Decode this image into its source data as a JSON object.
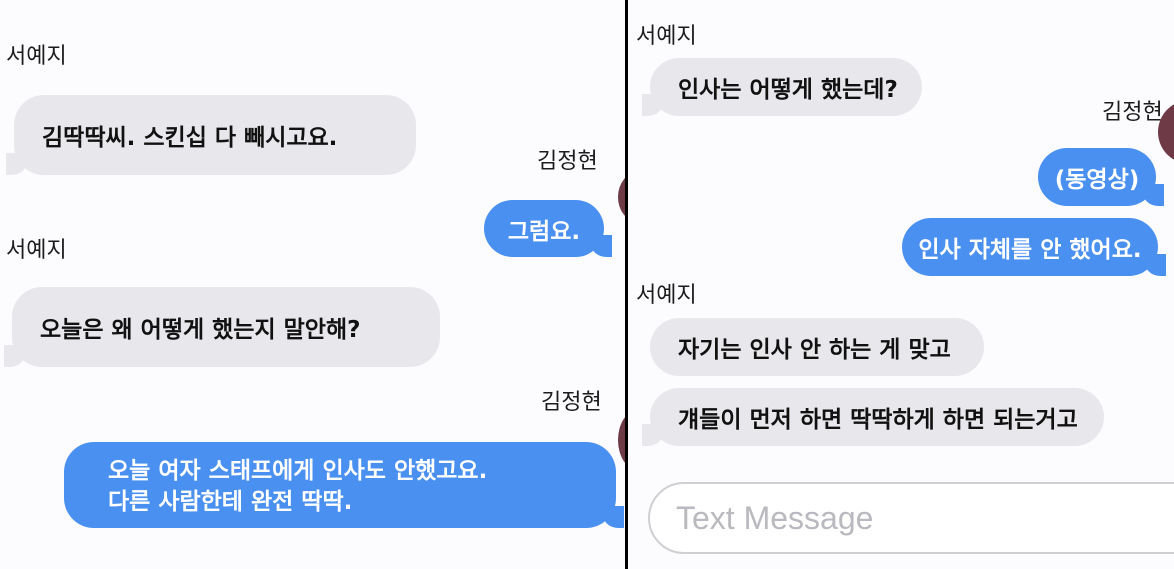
{
  "left": {
    "messages": [
      {
        "sender": "서예지",
        "text": "김딱딱씨. 스킨십 다 빼시고요."
      },
      {
        "sender": "김정현",
        "text": "그럼요."
      },
      {
        "sender": "서예지",
        "text": "오늘은 왜 어떻게 했는지 말안해?"
      },
      {
        "sender": "김정현",
        "lines": [
          "오늘 여자 스태프에게 인사도 안했고요.",
          "다른 사람한테 완전 딱딱."
        ]
      }
    ]
  },
  "right": {
    "messages": [
      {
        "sender": "서예지",
        "text": "인사는 어떻게 했는데?"
      },
      {
        "sender": "김정현",
        "text": "(동영상)"
      },
      {
        "sender": "김정현",
        "text": "인사 자체를 안 했어요."
      },
      {
        "sender": "서예지",
        "text": "자기는 인사 안 하는 게 맞고"
      },
      {
        "sender": "서예지",
        "text": "걔들이 먼저 하면 딱딱하게 하면 되는거고"
      }
    ],
    "composer": {
      "placeholder": "Text Message"
    }
  },
  "colors": {
    "incoming_bubble": "#e8e8ec",
    "outgoing_bubble": "#4a90f0",
    "divider": "#000000"
  }
}
